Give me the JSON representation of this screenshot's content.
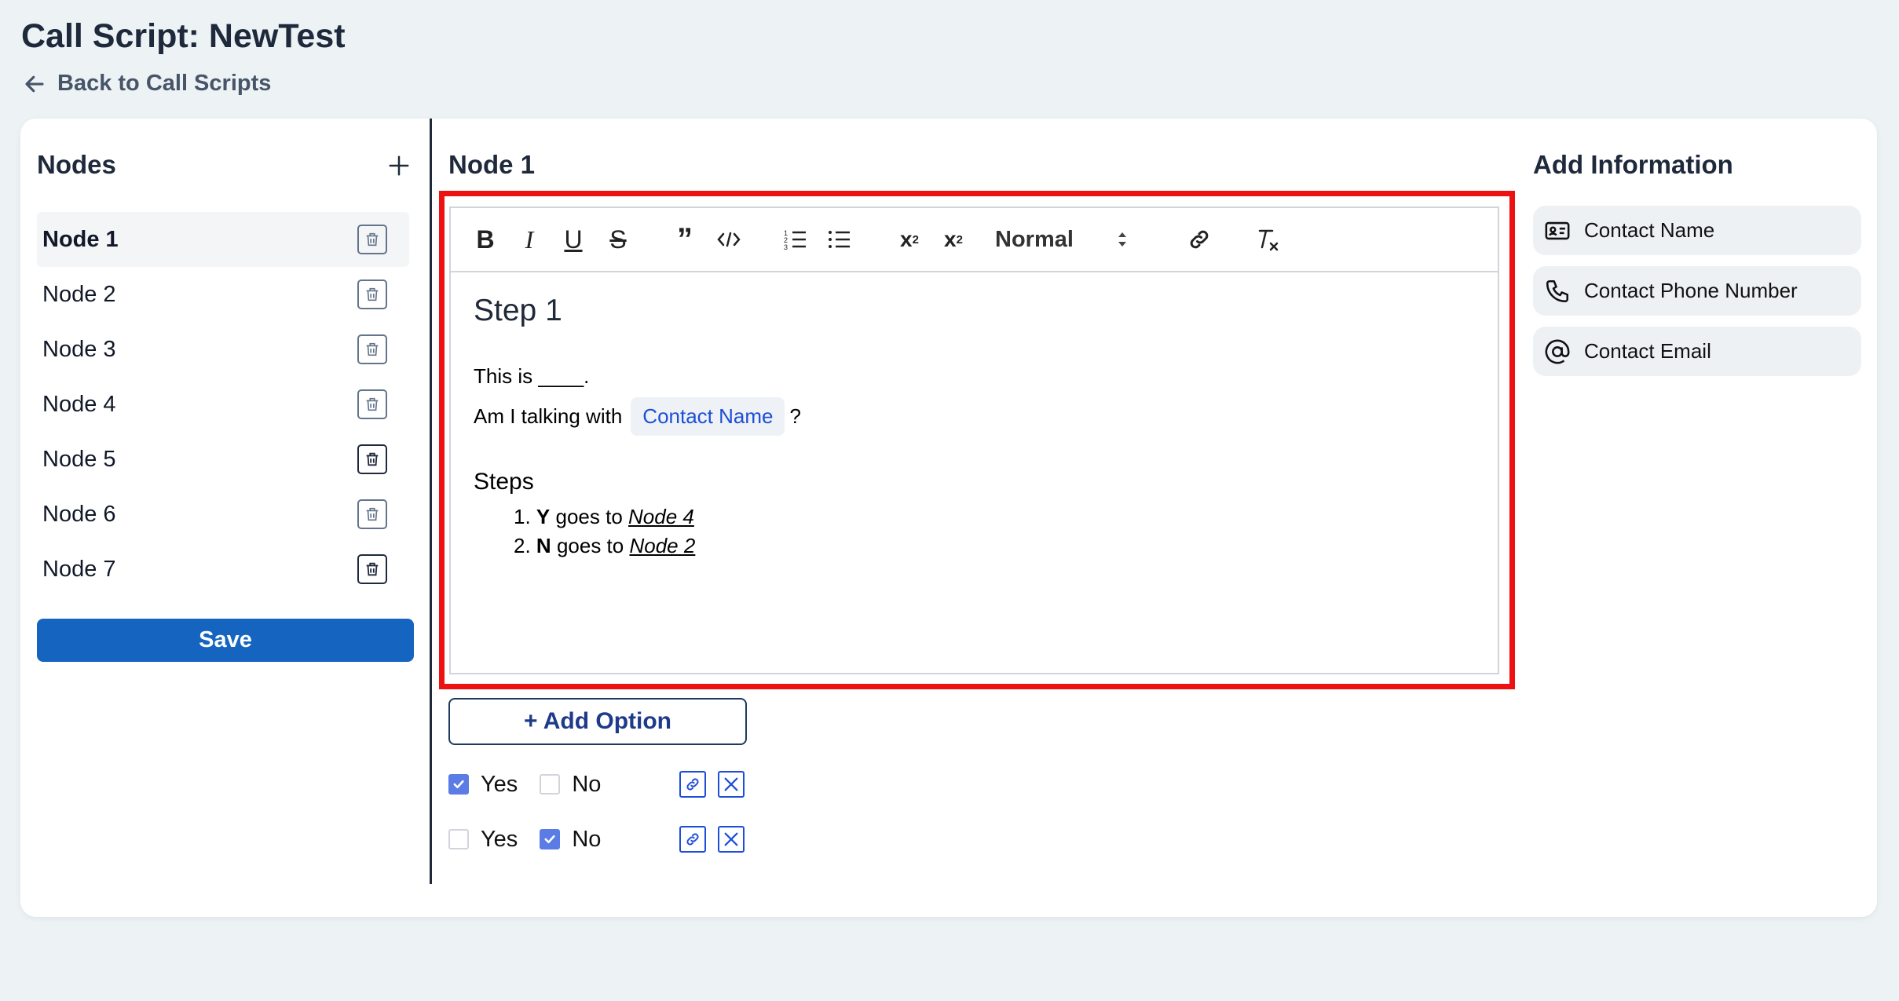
{
  "page": {
    "title": "Call Script: NewTest",
    "back_label": "Back to Call Scripts"
  },
  "nodes_panel": {
    "heading": "Nodes",
    "items": [
      {
        "label": "Node 1",
        "active": true
      },
      {
        "label": "Node 2"
      },
      {
        "label": "Node 3"
      },
      {
        "label": "Node 4"
      },
      {
        "label": "Node 5"
      },
      {
        "label": "Node 6"
      },
      {
        "label": "Node 7"
      }
    ],
    "save_label": "Save"
  },
  "editor": {
    "heading": "Node 1",
    "toolbar": {
      "buttons": [
        "bold-icon",
        "italic-icon",
        "underline-icon",
        "strikethrough-icon",
        "blockquote-icon",
        "code-icon",
        "ordered-list-icon",
        "bullet-list-icon",
        "subscript-icon",
        "superscript-icon",
        "link-icon",
        "clear-format-icon"
      ],
      "heading_select": "Normal"
    },
    "content": {
      "title": "Step 1",
      "line1": "This is ____.",
      "line2_prefix": "Am I talking with",
      "chip": "Contact Name",
      "line2_suffix": "?",
      "steps_title": "Steps",
      "steps": [
        {
          "num": "1.",
          "key": "Y",
          "text": "goes to",
          "target": "Node 4"
        },
        {
          "num": "2.",
          "key": "N",
          "text": "goes to",
          "target": "Node 2"
        }
      ]
    },
    "add_option_label": "+ Add Option",
    "options": [
      {
        "yes_label": "Yes",
        "no_label": "No",
        "yes_checked": true,
        "no_checked": false
      },
      {
        "yes_label": "Yes",
        "no_label": "No",
        "yes_checked": false,
        "no_checked": true
      }
    ]
  },
  "info_panel": {
    "heading": "Add Information",
    "items": [
      {
        "label": "Contact Name",
        "icon": "contact-card-icon"
      },
      {
        "label": "Contact Phone Number",
        "icon": "phone-icon"
      },
      {
        "label": "Contact Email",
        "icon": "at-sign-icon"
      }
    ]
  },
  "colors": {
    "background": "#edf2f5",
    "primary": "#1565c0",
    "highlight": "#ee1111",
    "checkbox": "#5b7ce5"
  }
}
